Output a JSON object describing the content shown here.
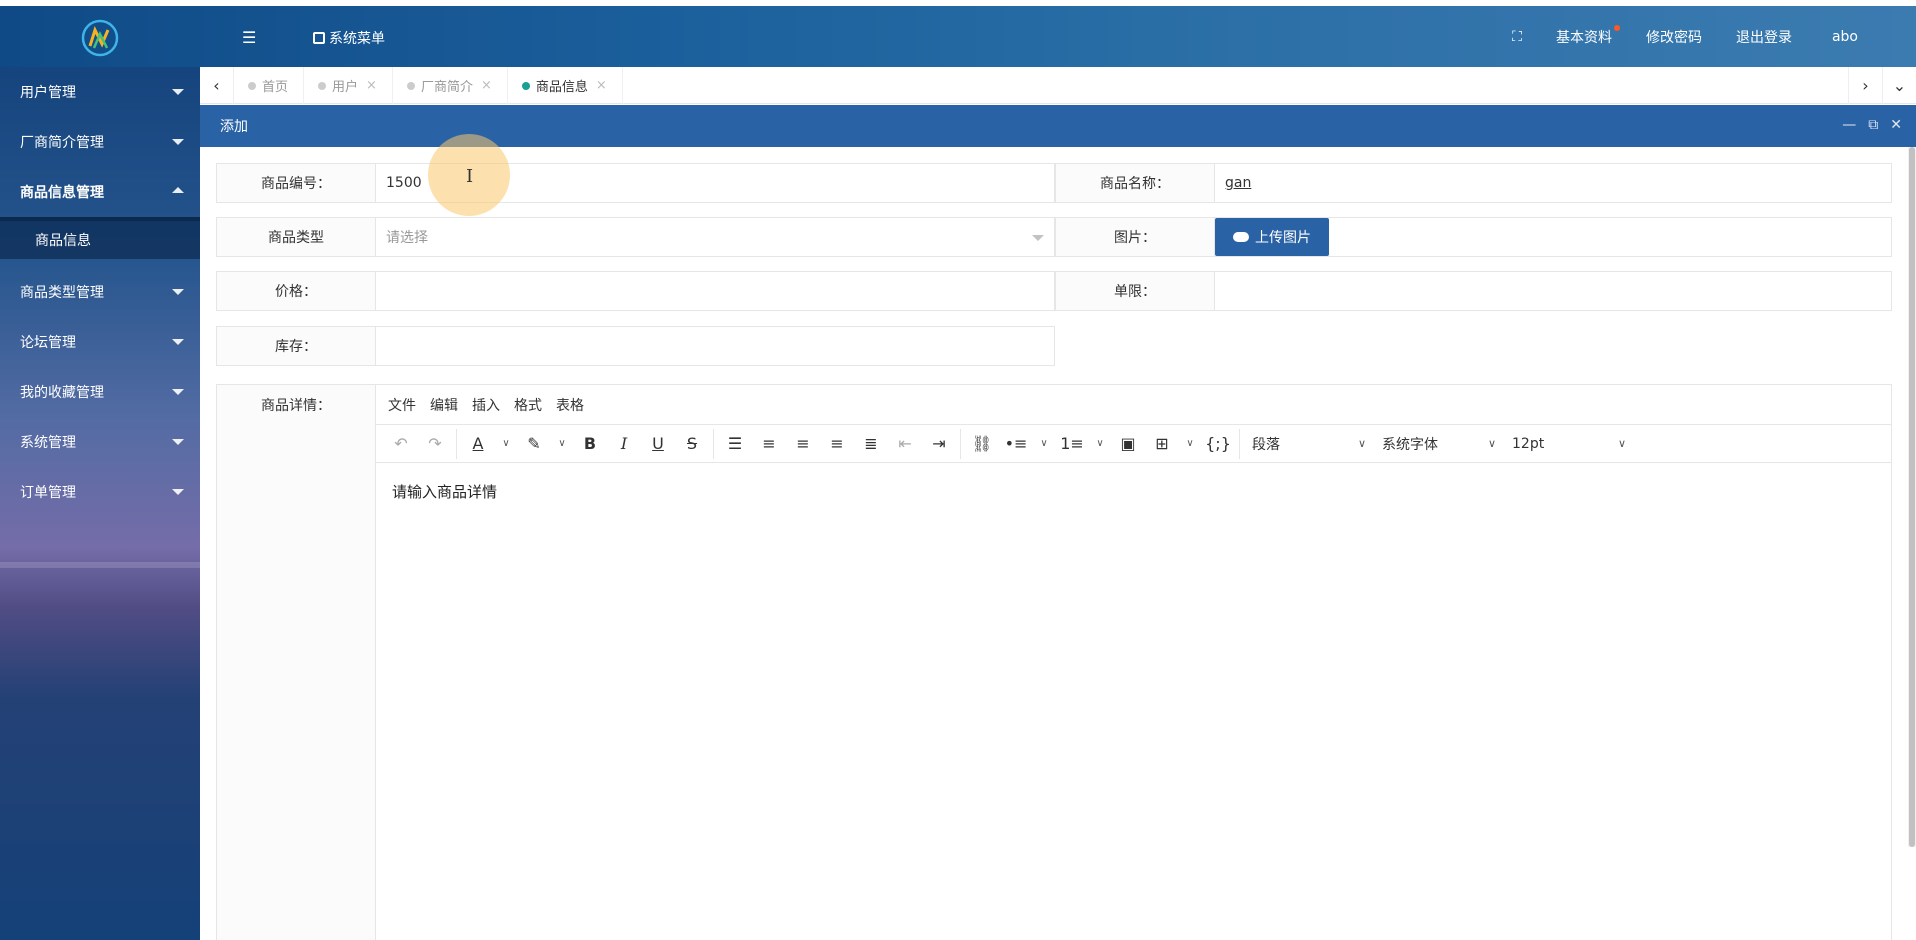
{
  "header": {
    "menu_icon": "menu-icon",
    "system_menu_label": "系统菜单",
    "fullscreen_icon": "expand-icon",
    "profile_label": "基本资料",
    "change_password_label": "修改密码",
    "logout_label": "退出登录",
    "username": "abo"
  },
  "sidebar": {
    "items": [
      {
        "label": "用户管理"
      },
      {
        "label": "厂商简介管理"
      },
      {
        "label": "商品信息管理"
      },
      {
        "label": "商品信息"
      },
      {
        "label": "商品类型管理"
      },
      {
        "label": "论坛管理"
      },
      {
        "label": "我的收藏管理"
      },
      {
        "label": "系统管理"
      },
      {
        "label": "订单管理"
      }
    ]
  },
  "tabs": [
    {
      "label": "首页",
      "closable": false
    },
    {
      "label": "用户",
      "closable": true
    },
    {
      "label": "厂商简介",
      "closable": true
    },
    {
      "label": "商品信息",
      "closable": true,
      "active": true
    }
  ],
  "tab_close_glyph": "×",
  "dialog": {
    "title": "添加",
    "form": {
      "product_code_label": "商品编号：",
      "product_code_value": "1500",
      "product_name_label": "商品名称：",
      "product_name_value": "gan",
      "product_type_label": "商品类型",
      "product_type_placeholder": "请选择",
      "image_label": "图片：",
      "upload_button": "上传图片",
      "price_label": "价格：",
      "price_value": "",
      "limit_label": "单限：",
      "limit_value": "",
      "stock_label": "库存：",
      "stock_value": "",
      "detail_label": "商品详情："
    },
    "editor": {
      "menus": [
        "文件",
        "编辑",
        "插入",
        "格式",
        "表格"
      ],
      "block_format": "段落",
      "font_family": "系统字体",
      "font_size": "12pt",
      "content": "请输入商品详情"
    }
  },
  "colors": {
    "primary": "#2a62a6",
    "active_tab_dot": "#1aa094",
    "notify_dot": "#ff5722"
  }
}
